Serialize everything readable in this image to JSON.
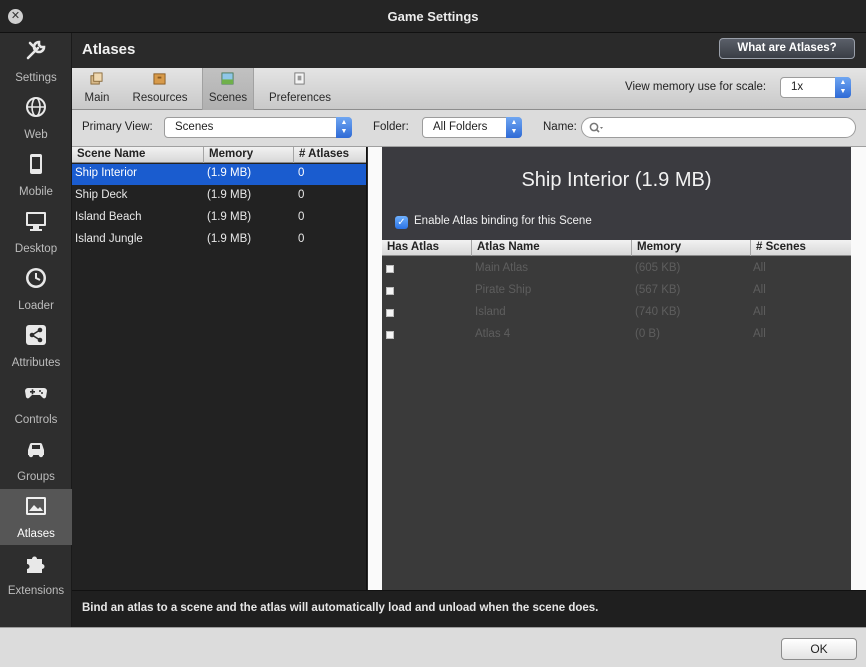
{
  "window": {
    "title": "Game Settings"
  },
  "sidebar": {
    "items": [
      {
        "label": "Settings",
        "icon": "wrench-icon"
      },
      {
        "label": "Web",
        "icon": "globe-icon"
      },
      {
        "label": "Mobile",
        "icon": "phone-icon"
      },
      {
        "label": "Desktop",
        "icon": "monitor-icon"
      },
      {
        "label": "Loader",
        "icon": "clock-icon"
      },
      {
        "label": "Attributes",
        "icon": "share-icon"
      },
      {
        "label": "Controls",
        "icon": "gamepad-icon"
      },
      {
        "label": "Groups",
        "icon": "car-icon"
      },
      {
        "label": "Atlases",
        "icon": "picture-icon",
        "active": true
      },
      {
        "label": "Extensions",
        "icon": "puzzle-icon"
      }
    ]
  },
  "header": {
    "title": "Atlases",
    "help_button": "What are Atlases?"
  },
  "toolbar": {
    "tabs": [
      {
        "label": "Main",
        "icon": "main-icon"
      },
      {
        "label": "Resources",
        "icon": "box-icon"
      },
      {
        "label": "Scenes",
        "icon": "scene-icon",
        "active": true
      },
      {
        "label": "Preferences",
        "icon": "preferences-icon"
      }
    ],
    "memory_label": "View memory use for scale:",
    "scale_value": "1x"
  },
  "filters": {
    "primary_view_label": "Primary View:",
    "primary_view_value": "Scenes",
    "folder_label": "Folder:",
    "folder_value": "All Folders",
    "name_label": "Name:",
    "name_value": ""
  },
  "scenes": {
    "columns": [
      "Scene Name",
      "Memory",
      "# Atlases"
    ],
    "rows": [
      {
        "name": "Ship Interior",
        "memory": "(1.9 MB)",
        "atlases": "0",
        "selected": true
      },
      {
        "name": "Ship Deck",
        "memory": "(1.9 MB)",
        "atlases": "0"
      },
      {
        "name": "Island Beach",
        "memory": "(1.9 MB)",
        "atlases": "0"
      },
      {
        "name": "Island Jungle",
        "memory": "(1.9 MB)",
        "atlases": "0"
      }
    ]
  },
  "detail": {
    "title": "Ship Interior (1.9 MB)",
    "enable_binding_label": "Enable Atlas binding for this Scene",
    "enable_binding_checked": true,
    "columns": [
      "Has Atlas",
      "Atlas Name",
      "Memory",
      "# Scenes"
    ],
    "rows": [
      {
        "has_atlas": false,
        "name": "Main Atlas",
        "memory": "(605 KB)",
        "scenes": "All"
      },
      {
        "has_atlas": false,
        "name": "Pirate Ship",
        "memory": "(567 KB)",
        "scenes": "All"
      },
      {
        "has_atlas": false,
        "name": "Island",
        "memory": "(740 KB)",
        "scenes": "All"
      },
      {
        "has_atlas": false,
        "name": "Atlas 4",
        "memory": "(0 B)",
        "scenes": "All"
      }
    ]
  },
  "status": {
    "message": "Bind an atlas to a scene and the atlas will automatically load and unload when the scene does."
  },
  "footer": {
    "ok_button": "OK"
  }
}
